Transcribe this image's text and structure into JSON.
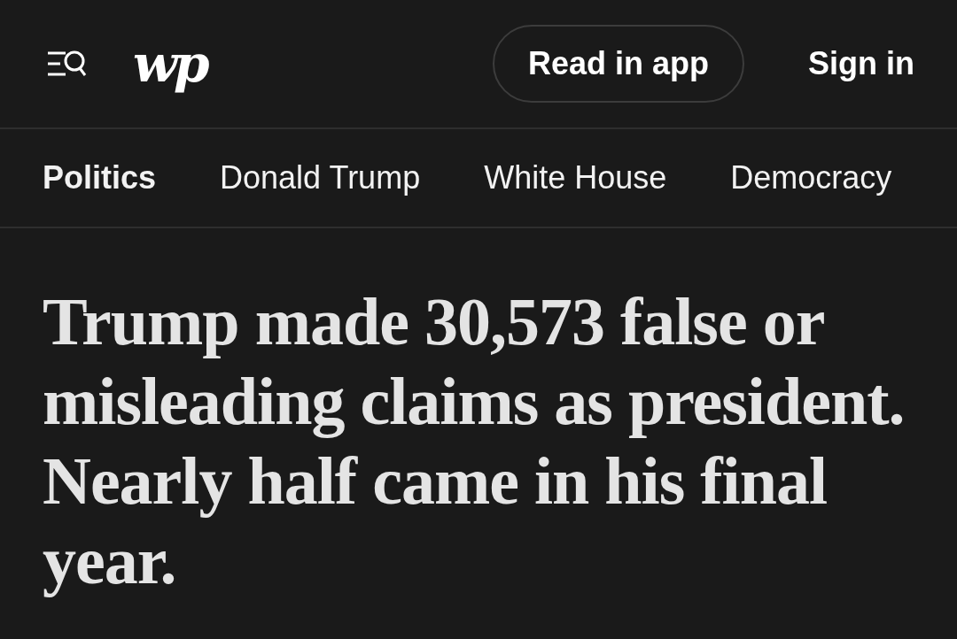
{
  "header": {
    "logo": "wp",
    "read_in_app": "Read in app",
    "sign_in": "Sign in"
  },
  "nav": [
    {
      "label": "Politics",
      "selected": true
    },
    {
      "label": "Donald Trump",
      "selected": false
    },
    {
      "label": "White House",
      "selected": false
    },
    {
      "label": "Democracy",
      "selected": false
    }
  ],
  "headline": "Trump made 30,573 false or misleading claims as president. Nearly half came in his final year."
}
